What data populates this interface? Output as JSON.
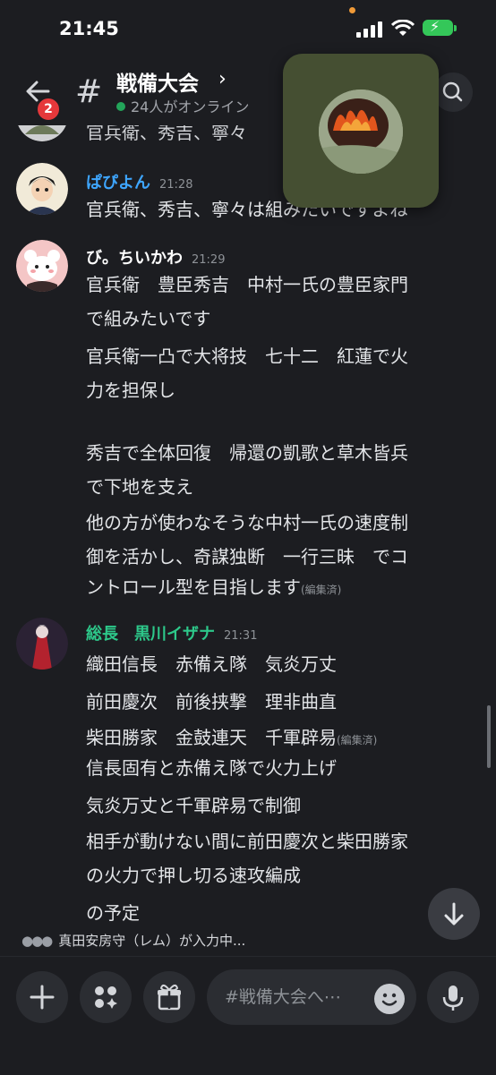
{
  "status_bar": {
    "time": "21:45"
  },
  "header": {
    "badge": "2",
    "channel_title": "戦備大会",
    "chevron": "›",
    "online": "24人がオンライン"
  },
  "messages": {
    "partial_top": "官兵衛、秀吉、寧々",
    "m1": {
      "author": "ぱぴよん",
      "time": "21:28",
      "lines": [
        "官兵衛、秀吉、寧々は組みたいですよね"
      ]
    },
    "m2": {
      "author": "び。ちいかわ",
      "time": "21:29",
      "lines": [
        "官兵衛　豊臣秀吉　中村一氏の豊臣家門",
        "で組みたいです",
        "官兵衛一凸で大将技　七十二　紅蓮で火",
        "力を担保し",
        "秀吉で全体回復　帰還の凱歌と草木皆兵",
        "で下地を支え",
        "他の方が使わなそうな中村一氏の速度制",
        "御を活かし、奇謀独断　一行三昧　でコ",
        "ントロール型を目指します"
      ],
      "edited": "(編集済)"
    },
    "m3": {
      "author": "総長　黒川イザナ",
      "time": "21:31",
      "lines": [
        "織田信長　赤備え隊　気炎万丈",
        "前田慶次　前後挟撃　理非曲直",
        "柴田勝家　金鼓連天　千軍辟易",
        "信長固有と赤備え隊で火力上げ",
        "気炎万丈と千軍辟易で制御",
        "相手が動けない間に前田慶次と柴田勝家",
        "の火力で押し切る速攻編成",
        "の予定"
      ],
      "edited": "(編集済)"
    }
  },
  "typing_indicator": "真田安房守（レム）が入力中...",
  "composer": {
    "placeholder": "#戦備大会へ⋯"
  },
  "colors": {
    "author_papiyon": "#3ea6ff",
    "author_chiikawa": "#ffffff",
    "author_izana": "#2dc88a"
  }
}
